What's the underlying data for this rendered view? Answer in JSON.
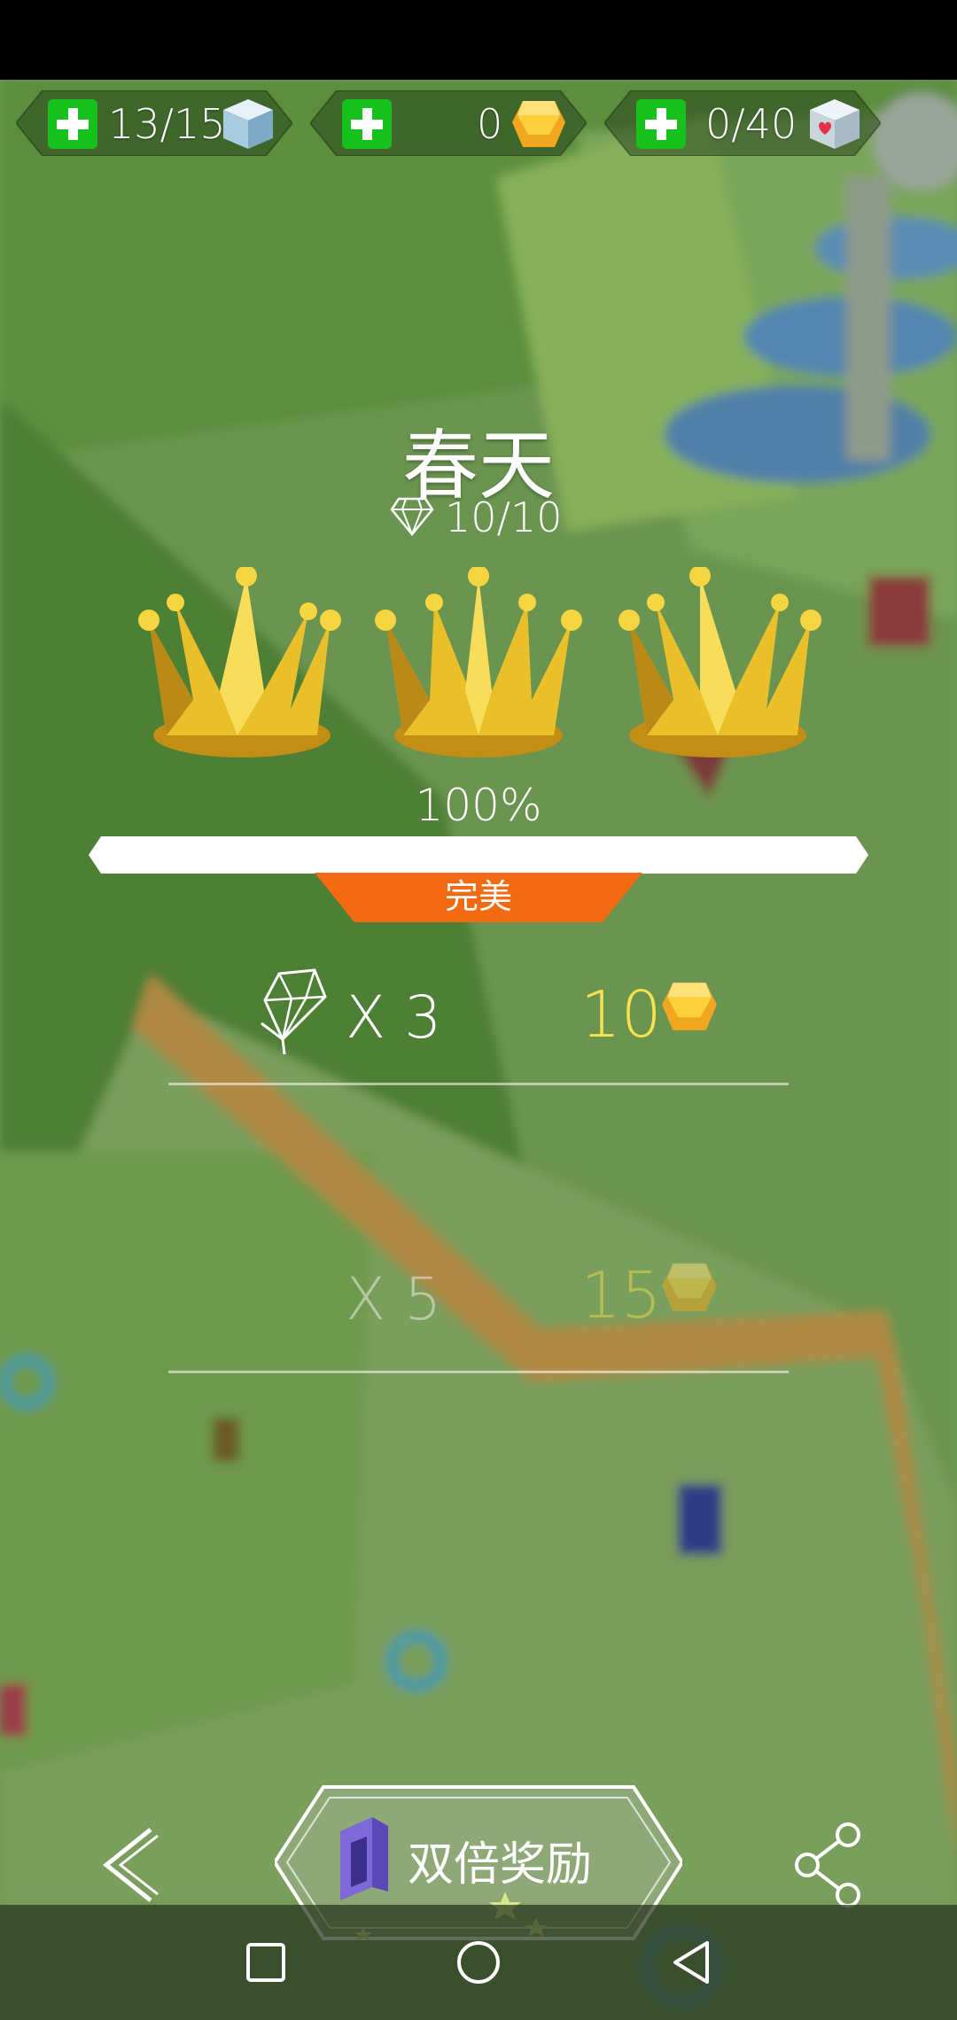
{
  "resources": {
    "energy": {
      "value": "13/15",
      "icon": "ice-cube-icon"
    },
    "coins": {
      "value": "0",
      "icon": "gold-gem-icon"
    },
    "hearts": {
      "value": "0/40",
      "icon": "heart-cube-icon"
    }
  },
  "level": {
    "title": "春天",
    "gems": "10/10",
    "crowns": 3,
    "percent": "100%",
    "progress": 1.0,
    "rank": "完美"
  },
  "rewards": [
    {
      "multiplier": "X 3",
      "amount": "10",
      "active": true
    },
    {
      "multiplier": "X 5",
      "amount": "15",
      "active": false
    }
  ],
  "actions": {
    "double_reward": "双倍奖励"
  },
  "colors": {
    "plus_green": "#16c11e",
    "rank_orange": "#f26a12",
    "reward_gold": "#f7e24e",
    "crown_gold": "#e8c02a"
  }
}
